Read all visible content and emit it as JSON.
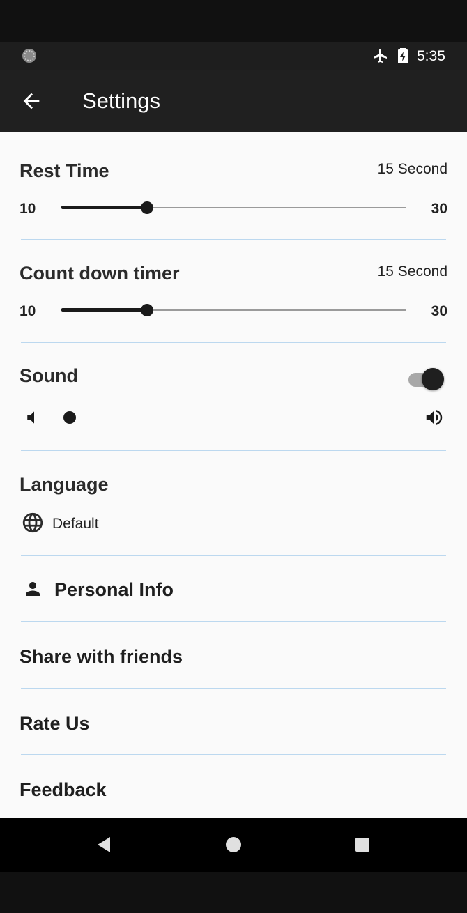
{
  "status_bar": {
    "time": "5:35",
    "icons": [
      "notification-icon",
      "airplane-mode-icon",
      "battery-charging-icon"
    ]
  },
  "app_bar": {
    "title": "Settings",
    "back_icon": "arrow-back-icon"
  },
  "rest_time": {
    "label": "Rest Time",
    "value_text": "15 Second",
    "min": "10",
    "max": "30",
    "value": 15
  },
  "countdown": {
    "label": "Count down timer",
    "value_text": "15 Second",
    "min": "10",
    "max": "30",
    "value": 15
  },
  "sound": {
    "label": "Sound",
    "enabled": true,
    "volume_fraction": 0.0,
    "icons": [
      "volume-low-icon",
      "volume-high-icon"
    ]
  },
  "language": {
    "label": "Language",
    "value": "Default",
    "icon": "globe-icon"
  },
  "items": {
    "personal_info": "Personal Info",
    "share": "Share with friends",
    "rate": "Rate Us",
    "feedback": "Feedback"
  },
  "nav_bar": {
    "icons": [
      "nav-back-icon",
      "nav-home-icon",
      "nav-recents-icon"
    ]
  },
  "colors": {
    "app_bar": "#202020",
    "background": "#fafafa",
    "divider": "#bcd8ef",
    "accent": "#1a1a1a"
  }
}
